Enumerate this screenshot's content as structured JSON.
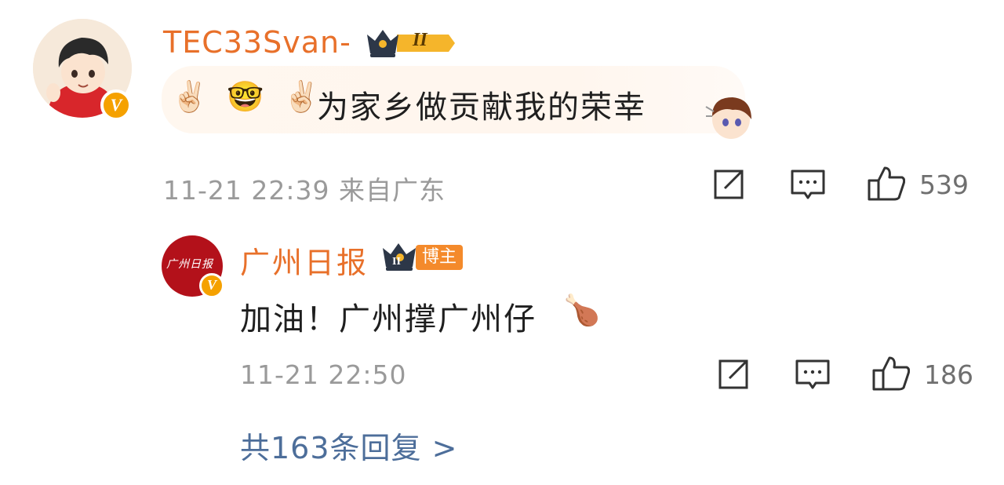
{
  "comment": {
    "username": "TEC33Svan-",
    "level": "II",
    "emoji_line": "✌🏻 🤓 ✌🏻",
    "text": "为家乡做贡献我的荣幸",
    "meta": "11-21 22:39 来自广东",
    "like_count": "539",
    "verified_badge": "V"
  },
  "reply": {
    "username": "广州日报",
    "badge_label": "博主",
    "level": "II",
    "text": "加油！广州撑广州仔",
    "emoji": "🍗",
    "meta": "11-21 22:50",
    "like_count": "186",
    "avatar_text": "广州日报",
    "verified_badge": "V"
  },
  "more_replies": "共163条回复 >",
  "colors": {
    "username": "#e8702a",
    "link": "#4d6e9a",
    "meta": "#9a9a9a",
    "badge_orange": "#f5a100",
    "avatar_red": "#b3111a"
  }
}
